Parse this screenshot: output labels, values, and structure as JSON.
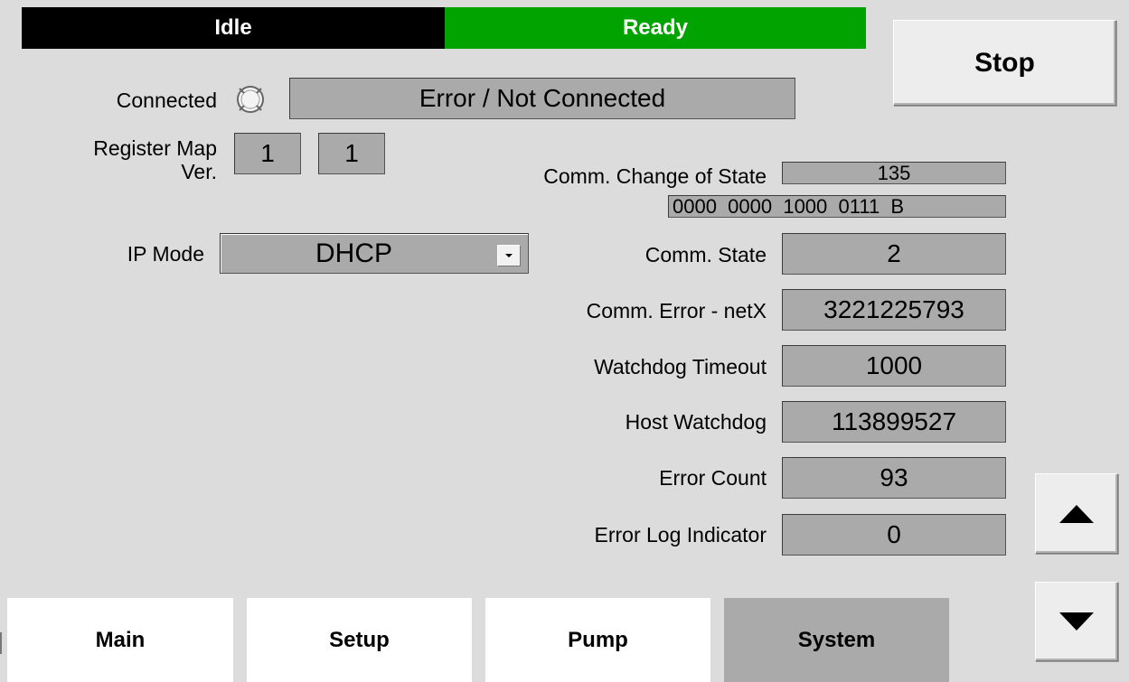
{
  "status_bar": {
    "left": {
      "text": "Idle",
      "color": "#000000"
    },
    "right": {
      "text": "Ready",
      "color": "#00a300"
    }
  },
  "buttons": {
    "stop": "Stop",
    "scroll_up_icon": "triangle-up-icon",
    "scroll_down_icon": "triangle-down-icon"
  },
  "connection": {
    "label": "Connected",
    "indicator_icon": "status-led-off-icon",
    "status_text": "Error / Not Connected"
  },
  "register_map": {
    "label_line1": "Register Map",
    "label_line2": "Ver.",
    "major": "1",
    "minor": "1"
  },
  "ip_mode": {
    "label": "IP Mode",
    "value": "DHCP"
  },
  "comm_change_of_state": {
    "label": "Comm. Change of State",
    "decimal": "135",
    "binary": "0000  0000  1000  0111  B"
  },
  "fields": [
    {
      "label": "Comm. State",
      "value": "2"
    },
    {
      "label": "Comm. Error - netX",
      "value": "3221225793"
    },
    {
      "label": "Watchdog Timeout",
      "value": "1000"
    },
    {
      "label": "Host Watchdog",
      "value": "113899527"
    },
    {
      "label": "Error Count",
      "value": "93"
    },
    {
      "label": "Error Log Indicator",
      "value": "0"
    }
  ],
  "tabs": [
    {
      "label": "Main",
      "active": false
    },
    {
      "label": "Setup",
      "active": false
    },
    {
      "label": "Pump",
      "active": false
    },
    {
      "label": "System",
      "active": true
    }
  ]
}
